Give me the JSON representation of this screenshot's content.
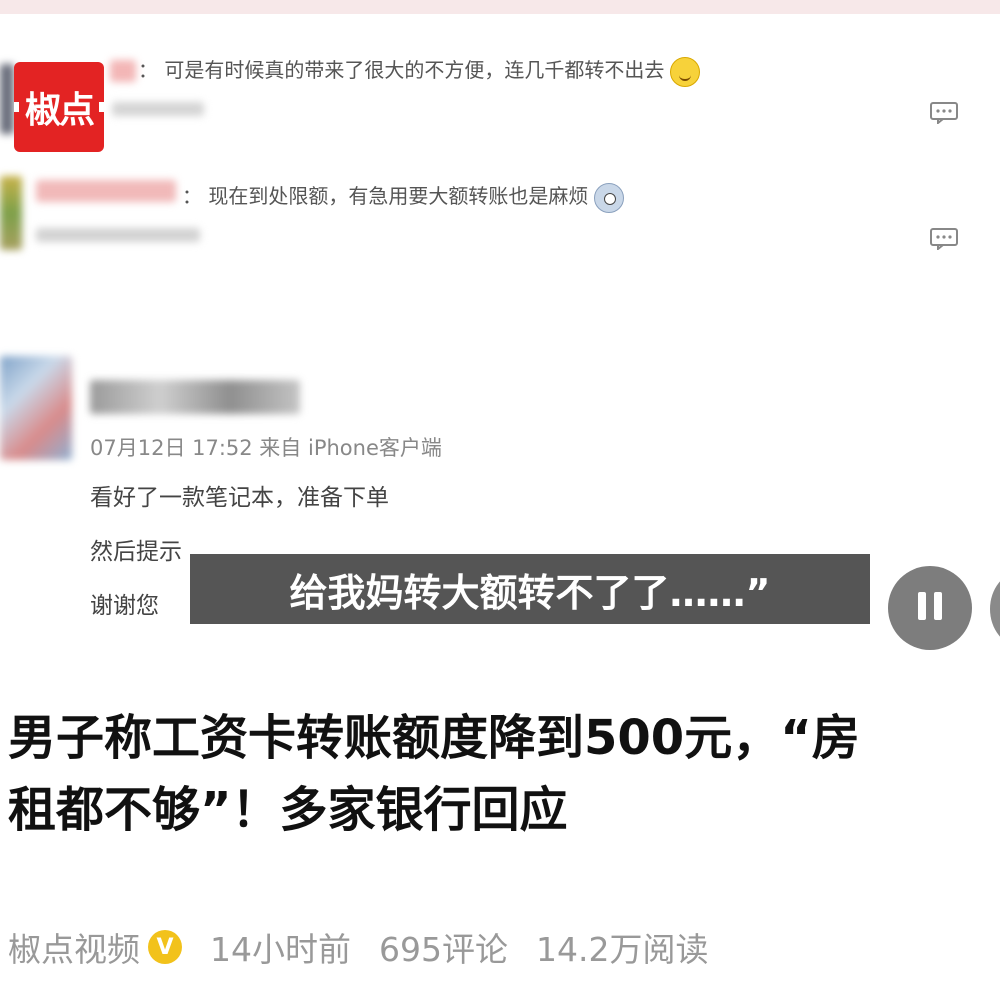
{
  "logo": {
    "text": "椒点"
  },
  "comments": [
    {
      "text": "： 可是有时候真的带来了很大的不方便，连几千都转不出去",
      "emoji": "smile-emoji"
    },
    {
      "text": "： 现在到处限额，有急用要大额转账也是麻烦",
      "emoji": "sweat-emoji"
    }
  ],
  "post": {
    "time_source": "07月12日 17:52 来自 iPhone客户端",
    "line1": "看好了一款笔记本，准备下单",
    "line2": "然后提示",
    "line3": "谢谢您"
  },
  "video": {
    "subtitle": "给我妈转大额转不了了……”",
    "pause_icon": "pause-icon"
  },
  "article": {
    "title_line1": "男子称工资卡转账额度降到500元，“房",
    "title_line2": "租都不够”！多家银行回应",
    "source": "椒点视频",
    "verified_badge": "V",
    "time": "14小时前",
    "comments": "695评论",
    "reads": "14.2万阅读"
  },
  "colors": {
    "brand_red": "#e32323",
    "badge_yellow": "#f2c21b"
  }
}
